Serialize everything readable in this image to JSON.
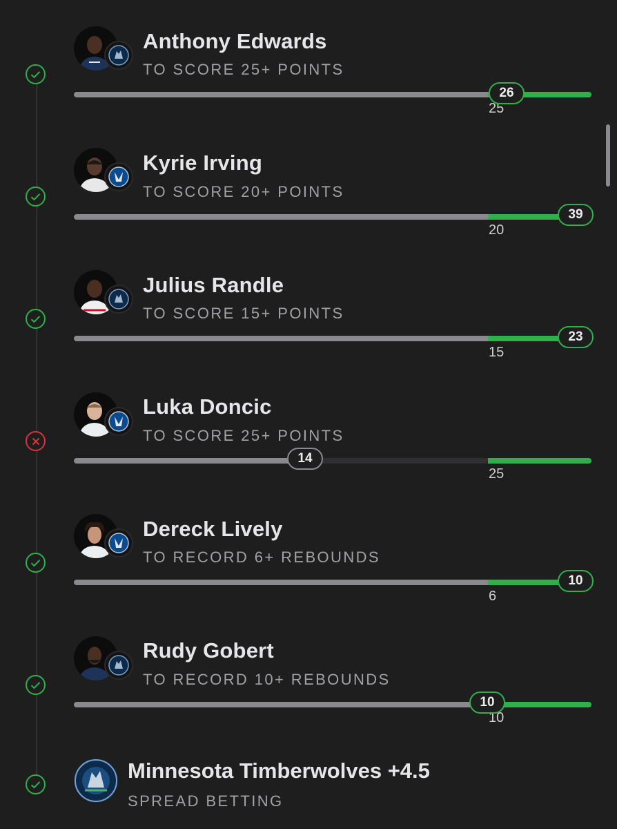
{
  "legs": [
    {
      "player": "Anthony Edwards",
      "prop": "TO SCORE 25+ POINTS",
      "target": "25",
      "actual": "26",
      "result": "won",
      "team_icon": "timberwolves-logo-icon",
      "progress_fraction": 0.84
    },
    {
      "player": "Kyrie Irving",
      "prop": "TO SCORE 20+ POINTS",
      "target": "20",
      "actual": "39",
      "result": "won",
      "team_icon": "mavericks-logo-icon",
      "progress_fraction": 1.0
    },
    {
      "player": "Julius Randle",
      "prop": "TO SCORE 15+ POINTS",
      "target": "15",
      "actual": "23",
      "result": "won",
      "team_icon": "timberwolves-logo-icon",
      "progress_fraction": 1.0
    },
    {
      "player": "Luka Doncic",
      "prop": "TO SCORE 25+ POINTS",
      "target": "25",
      "actual": "14",
      "result": "lost",
      "team_icon": "mavericks-logo-icon",
      "progress_fraction": 0.56
    },
    {
      "player": "Dereck Lively",
      "prop": "TO RECORD 6+ REBOUNDS",
      "target": "6",
      "actual": "10",
      "result": "won",
      "team_icon": "mavericks-logo-icon",
      "progress_fraction": 1.0
    },
    {
      "player": "Rudy Gobert",
      "prop": "TO RECORD 10+ REBOUNDS",
      "target": "10",
      "actual": "10",
      "result": "won",
      "team_icon": "timberwolves-logo-icon",
      "progress_fraction": 0.8
    }
  ],
  "spread": {
    "title": "Minnesota Timberwolves +4.5",
    "subtitle": "SPREAD BETTING",
    "result": "won",
    "team_icon": "timberwolves-logo-icon"
  },
  "colors": {
    "won": "#2fb04a",
    "lost": "#d8343d",
    "background": "#1e1e1f"
  }
}
